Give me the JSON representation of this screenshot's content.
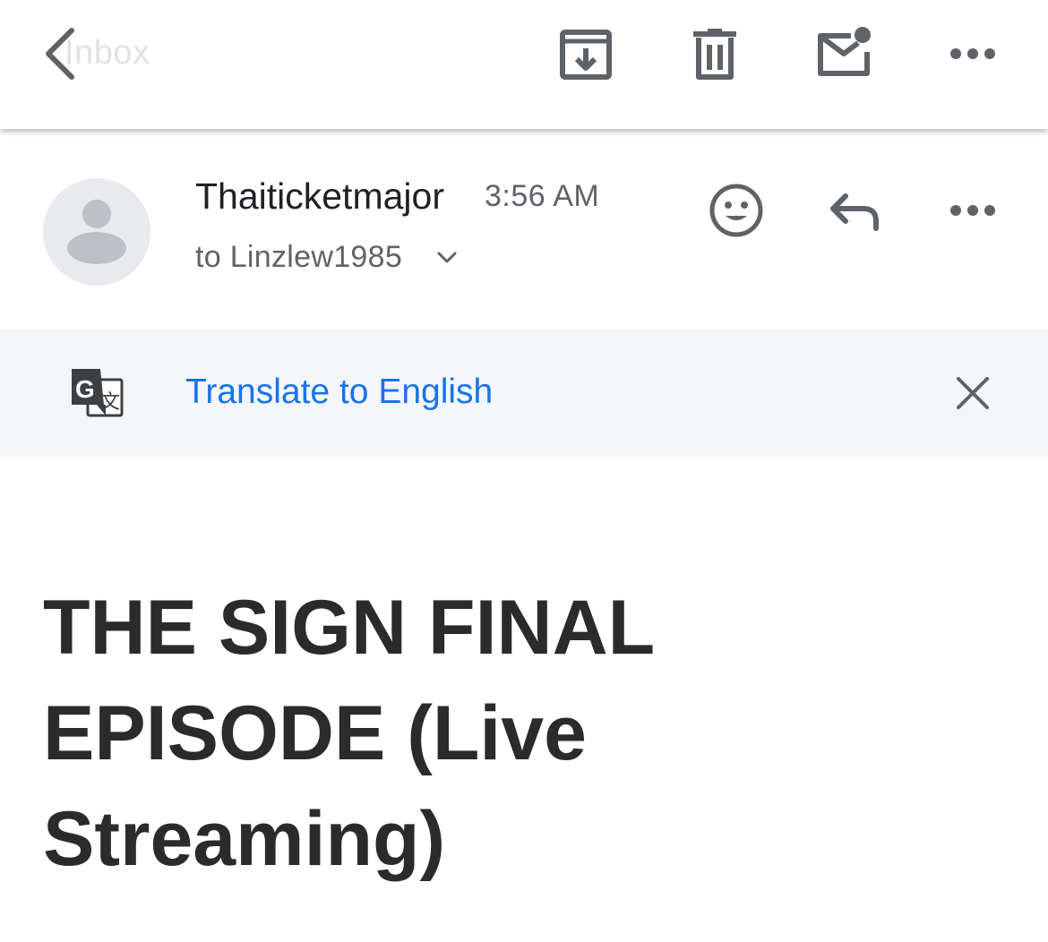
{
  "toolbar": {
    "back_label": "Inbox",
    "icons": [
      "chevron-left-icon",
      "archive-icon",
      "trash-icon",
      "mark-unread-icon",
      "more-horiz-icon"
    ]
  },
  "message": {
    "sender": "Thaiticketmajor",
    "time": "3:56 AM",
    "recipient": "to Linzlew1985"
  },
  "translate": {
    "link_text": "Translate to English",
    "icon": "google-translate-icon"
  },
  "subject": "THE SIGN FINAL EPISODE (Live Streaming)",
  "colors": {
    "link_blue": "#1a73e8",
    "icon_gray": "#5f6368",
    "banner_bg": "#f4f6fa",
    "avatar_bg": "#e8eaed"
  }
}
